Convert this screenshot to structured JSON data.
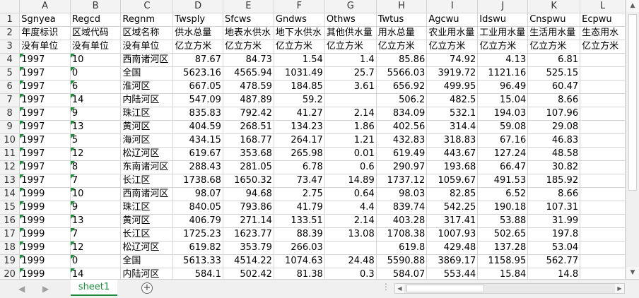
{
  "columns": [
    "A",
    "B",
    "C",
    "D",
    "E",
    "F",
    "G",
    "H",
    "I",
    "J",
    "K",
    "L"
  ],
  "rows": [
    [
      "Sgnyea",
      "Regcd",
      "Regnm",
      "Twsply",
      "Sfcws",
      "Gndws",
      "Othws",
      "Twtus",
      "Agcwu",
      "Idswu",
      "Cnspwu",
      "Ecpwu"
    ],
    [
      "年度标识",
      "区域代码",
      "区域名称",
      "供水总量",
      "地表水供水",
      "地下水供水",
      "其他供水量",
      "用水总量",
      "农业用水量",
      "工业用水量",
      "生活用水量",
      "生态用水"
    ],
    [
      "没有单位",
      "没有单位",
      "没有单位",
      "亿立方米",
      "亿立方米",
      "亿立方米",
      "亿立方米",
      "亿立方米",
      "亿立方米",
      "亿立方米",
      "亿立方米",
      "亿立方米"
    ],
    [
      "1997",
      "10",
      "西南诸河区",
      "87.67",
      "84.73",
      "1.54",
      "1.4",
      "85.86",
      "74.92",
      "4.13",
      "6.81",
      ""
    ],
    [
      "1997",
      "0",
      "全国",
      "5623.16",
      "4565.94",
      "1031.49",
      "25.7",
      "5566.03",
      "3919.72",
      "1121.16",
      "525.15",
      ""
    ],
    [
      "1997",
      "6",
      "淮河区",
      "667.05",
      "478.59",
      "184.85",
      "3.61",
      "656.92",
      "499.95",
      "96.49",
      "60.47",
      ""
    ],
    [
      "1997",
      "14",
      "内陆河区",
      "547.09",
      "487.89",
      "59.2",
      "",
      "506.2",
      "482.5",
      "15.04",
      "8.66",
      ""
    ],
    [
      "1997",
      "9",
      "珠江区",
      "835.83",
      "792.42",
      "41.27",
      "2.14",
      "834.09",
      "532.1",
      "194.03",
      "107.96",
      ""
    ],
    [
      "1997",
      "13",
      "黄河区",
      "404.59",
      "268.51",
      "134.23",
      "1.86",
      "402.56",
      "314.4",
      "59.08",
      "29.08",
      ""
    ],
    [
      "1997",
      "5",
      "海河区",
      "434.15",
      "168.77",
      "264.17",
      "1.21",
      "432.83",
      "318.83",
      "67.16",
      "46.83",
      ""
    ],
    [
      "1997",
      "12",
      "松辽河区",
      "619.67",
      "353.68",
      "265.98",
      "0.01",
      "619.49",
      "443.67",
      "127.24",
      "48.58",
      ""
    ],
    [
      "1997",
      "8",
      "东南诸河区",
      "288.43",
      "281.05",
      "6.78",
      "0.6",
      "290.97",
      "193.68",
      "66.47",
      "30.82",
      ""
    ],
    [
      "1997",
      "7",
      "长江区",
      "1738.68",
      "1650.32",
      "73.47",
      "14.89",
      "1737.12",
      "1059.67",
      "491.53",
      "185.92",
      ""
    ],
    [
      "1999",
      "10",
      "西南诸河区",
      "98.07",
      "94.68",
      "2.75",
      "0.64",
      "98.03",
      "82.85",
      "6.52",
      "8.66",
      ""
    ],
    [
      "1999",
      "9",
      "珠江区",
      "840.05",
      "793.86",
      "41.79",
      "4.4",
      "839.74",
      "542.25",
      "190.18",
      "107.31",
      ""
    ],
    [
      "1999",
      "13",
      "黄河区",
      "406.79",
      "271.14",
      "133.51",
      "2.14",
      "403.28",
      "317.41",
      "53.88",
      "31.99",
      ""
    ],
    [
      "1999",
      "7",
      "长江区",
      "1725.23",
      "1623.77",
      "88.39",
      "13.08",
      "1708.38",
      "1007.93",
      "502.65",
      "197.8",
      ""
    ],
    [
      "1999",
      "12",
      "松辽河区",
      "619.82",
      "353.79",
      "266.03",
      "",
      "619.8",
      "429.48",
      "137.28",
      "53.04",
      ""
    ],
    [
      "1999",
      "0",
      "全国",
      "5613.33",
      "4514.22",
      "1074.63",
      "24.48",
      "5590.88",
      "3869.17",
      "1158.95",
      "562.77",
      ""
    ],
    [
      "1999",
      "14",
      "内陆河区",
      "584.1",
      "502.42",
      "81.38",
      "0.3",
      "584.07",
      "553.44",
      "15.84",
      "14.8",
      ""
    ]
  ],
  "sheet_tab": "sheet1",
  "add_sheet_label": "+",
  "nav_prev": "◀",
  "nav_next": "▶",
  "dots": "⋮",
  "accent_color": "#1e8e3e"
}
